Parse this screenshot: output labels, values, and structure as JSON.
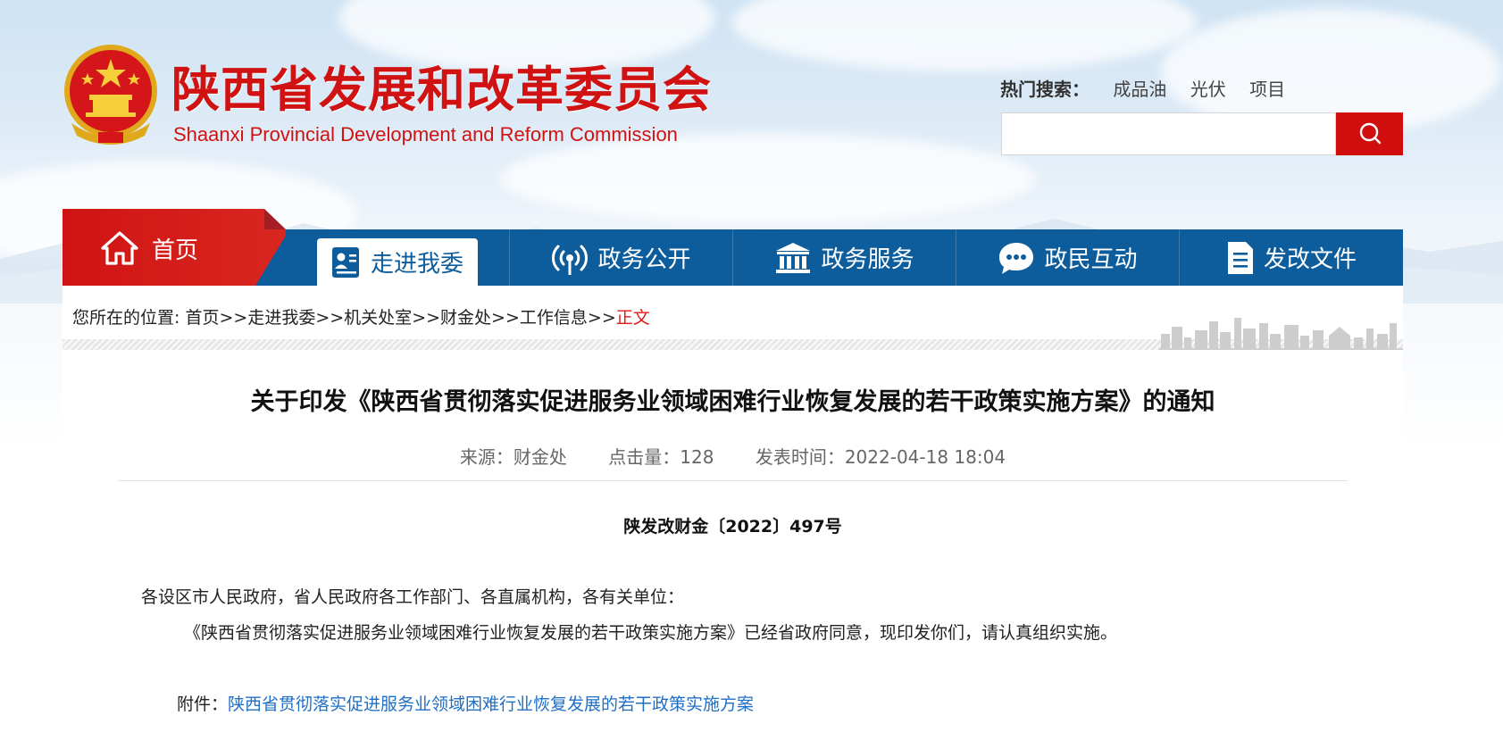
{
  "header": {
    "title": "陕西省发展和改革委员会",
    "subtitle": "Shaanxi Provincial Development and Reform Commission",
    "hot_search_label": "热门搜索：",
    "hot_search_terms": [
      "成品油",
      "光伏",
      "项目"
    ],
    "search_placeholder": ""
  },
  "nav": {
    "home": "首页",
    "items": [
      {
        "label": "走进我委",
        "icon": "person-card-icon",
        "active": true
      },
      {
        "label": "政务公开",
        "icon": "broadcast-icon",
        "active": false
      },
      {
        "label": "政务服务",
        "icon": "institution-icon",
        "active": false
      },
      {
        "label": "政民互动",
        "icon": "chat-bubble-icon",
        "active": false
      },
      {
        "label": "发改文件",
        "icon": "document-icon",
        "active": false
      }
    ]
  },
  "breadcrumb": {
    "prefix": "您所在的位置:",
    "items": [
      "首页",
      "走进我委",
      "机关处室",
      "财金处",
      "工作信息"
    ],
    "separator": ">>",
    "current": "正文"
  },
  "article": {
    "title": "关于印发《陕西省贯彻落实促进服务业领域困难行业恢复发展的若干政策实施方案》的通知",
    "source": "来源：财金处",
    "clicks": "点击量：128",
    "published": "发表时间：2022-04-18 18:04",
    "doc_number": "陕发改财金〔2022〕497号",
    "recipient": "各设区市人民政府，省人民政府各工作部门、各直属机构，各有关单位：",
    "body": "《陕西省贯彻落实促进服务业领域困难行业恢复发展的若干政策实施方案》已经省政府同意，现印发你们，请认真组织实施。",
    "attachment_label": "附件：",
    "attachment_link": "陕西省贯彻落实促进服务业领域困难行业恢复发展的若干政策实施方案"
  },
  "colors": {
    "brand_red": "#d01212",
    "nav_blue": "#0d5d9c",
    "link_blue": "#1f6fc5",
    "current_crumb": "#e01a1a"
  }
}
